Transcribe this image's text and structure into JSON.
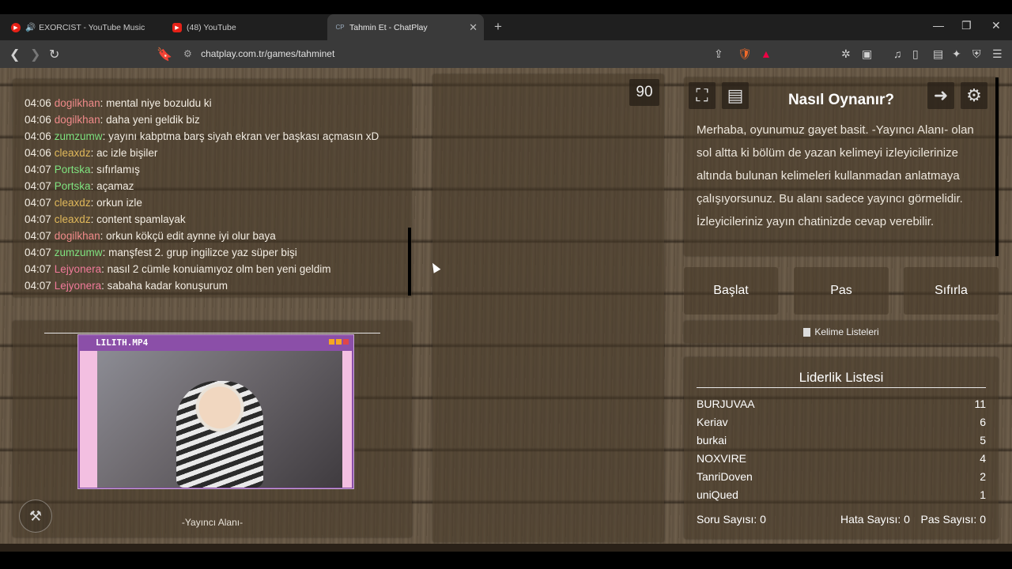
{
  "browser": {
    "tabs": [
      {
        "label": "EXORCIST - YouTube Music",
        "icon": "youtube-music-icon"
      },
      {
        "label": "(48) YouTube",
        "icon": "youtube-icon"
      },
      {
        "label": "Tahmin Et - ChatPlay",
        "icon": "chatplay-icon",
        "active": true
      }
    ],
    "url": "chatplay.com.tr/games/tahminet"
  },
  "chat": {
    "messages": [
      {
        "time": "04:06",
        "user": "dogilkhan",
        "color": "#f08a8a",
        "text": "mental niye bozuldu ki"
      },
      {
        "time": "04:06",
        "user": "dogilkhan",
        "color": "#f08a8a",
        "text": "daha yeni geldik biz"
      },
      {
        "time": "04:06",
        "user": "zumzumw",
        "color": "#7fe27f",
        "text": "yayını kabptma barş siyah ekran ver başkası açmasın xD"
      },
      {
        "time": "04:06",
        "user": "cleaxdz",
        "color": "#e0b85a",
        "text": "ac izle bişiler"
      },
      {
        "time": "04:07",
        "user": "Portska",
        "color": "#7fe27f",
        "text": "sıfırlamış"
      },
      {
        "time": "04:07",
        "user": "Portska",
        "color": "#7fe27f",
        "text": "açamaz"
      },
      {
        "time": "04:07",
        "user": "cleaxdz",
        "color": "#e0b85a",
        "text": "orkun izle"
      },
      {
        "time": "04:07",
        "user": "cleaxdz",
        "color": "#e0b85a",
        "text": "content spamlayak"
      },
      {
        "time": "04:07",
        "user": "dogilkhan",
        "color": "#f08a8a",
        "text": "orkun kökçü edit aynne iyi olur baya"
      },
      {
        "time": "04:07",
        "user": "zumzumw",
        "color": "#7fe27f",
        "text": "manşfest 2. grup ingilizce yaz süper bişi"
      },
      {
        "time": "04:07",
        "user": "Lejyonera",
        "color": "#f07a9a",
        "text": "nasıl 2 cümle konuiamıyoz olm ben yeni geldim"
      },
      {
        "time": "04:07",
        "user": "Lejyonera",
        "color": "#f07a9a",
        "text": "sabaha kadar konuşurum"
      }
    ]
  },
  "streamer": {
    "video_title": "LILITH.MP4",
    "label": "-Yayıncı Alanı-"
  },
  "board": {
    "timer": "90"
  },
  "howto": {
    "title": "Nasıl Oynanır?",
    "body": "Merhaba, oyunumuz gayet basit. -Yayıncı Alanı- olan sol altta ki bölüm de yazan kelimeyi izleyicilerinize altında bulunan kelimeleri kullanmadan anlatmaya çalışıyorsunuz. Bu alanı sadece yayıncı görmelidir. İzleyicileriniz yayın chatinizde cevap verebilir."
  },
  "controls": {
    "start": "Başlat",
    "pass": "Pas",
    "reset": "Sıfırla",
    "word_lists": "Kelime Listeleri"
  },
  "leaderboard": {
    "title": "Liderlik Listesi",
    "rows": [
      {
        "name": "BURJUVAA",
        "score": "11"
      },
      {
        "name": "Keriav",
        "score": "6"
      },
      {
        "name": "burkai",
        "score": "5"
      },
      {
        "name": "NOXVIRE",
        "score": "4"
      },
      {
        "name": "TanriDoven",
        "score": "2"
      },
      {
        "name": "uniQued",
        "score": "1"
      }
    ],
    "stats": {
      "questions": "Soru Sayısı: 0",
      "errors": "Hata Sayısı: 0",
      "passes": "Pas Sayısı: 0"
    }
  }
}
